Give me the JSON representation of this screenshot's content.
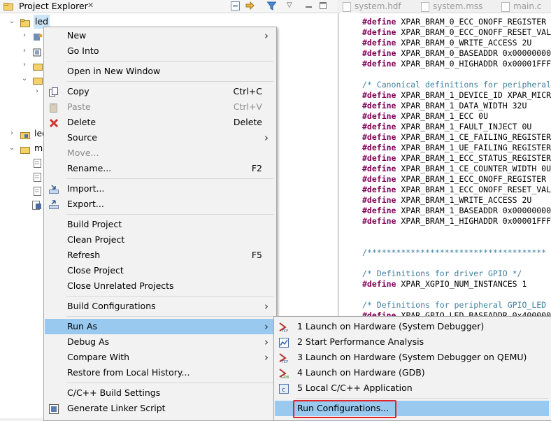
{
  "project_explorer": {
    "title": "Project Explorer",
    "tree": [
      {
        "label": "led",
        "level": 0,
        "expanded": true,
        "selected": true
      },
      {
        "label": "",
        "level": 1
      },
      {
        "label": "",
        "level": 1
      },
      {
        "label": "",
        "level": 1
      },
      {
        "label": "",
        "level": 1
      },
      {
        "label": "",
        "level": 2
      },
      {
        "label": "led",
        "level": 0
      },
      {
        "label": "ml",
        "level": 0,
        "expanded": true
      }
    ]
  },
  "editor_tabs": [
    "system.hdf",
    "system.mss",
    "main.c"
  ],
  "code_lines": [
    {
      "t": "#define XPAR_BRAM_0_ECC_ONOFF_REGISTER",
      "k": true
    },
    {
      "t": "#define XPAR_BRAM_0_ECC_ONOFF_RESET_VAL",
      "k": true
    },
    {
      "t": "#define XPAR_BRAM_0_WRITE_ACCESS 2U",
      "k": true
    },
    {
      "t": "#define XPAR_BRAM_0_BASEADDR 0x00000000",
      "k": true
    },
    {
      "t": "#define XPAR_BRAM_0_HIGHADDR 0x00001FFF",
      "k": true
    },
    {
      "t": "",
      "k": false
    },
    {
      "t": "/* Canonical definitions for peripheral",
      "c": true
    },
    {
      "t": "#define XPAR_BRAM_1_DEVICE_ID XPAR_MICR",
      "k": true
    },
    {
      "t": "#define XPAR_BRAM_1_DATA_WIDTH 32U",
      "k": true
    },
    {
      "t": "#define XPAR_BRAM_1_ECC 0U",
      "k": true
    },
    {
      "t": "#define XPAR_BRAM_1_FAULT_INJECT 0U",
      "k": true
    },
    {
      "t": "#define XPAR_BRAM_1_CE_FAILING_REGISTER",
      "k": true
    },
    {
      "t": "#define XPAR_BRAM_1_UE_FAILING_REGISTER",
      "k": true
    },
    {
      "t": "#define XPAR_BRAM_1_ECC_STATUS_REGISTER",
      "k": true
    },
    {
      "t": "#define XPAR_BRAM_1_CE_COUNTER_WIDTH 0U",
      "k": true
    },
    {
      "t": "#define XPAR_BRAM_1_ECC_ONOFF_REGISTER",
      "k": true
    },
    {
      "t": "#define XPAR_BRAM_1_ECC_ONOFF_RESET_VAL",
      "k": true
    },
    {
      "t": "#define XPAR_BRAM_1_WRITE_ACCESS 2U",
      "k": true
    },
    {
      "t": "#define XPAR_BRAM_1_BASEADDR 0x00000000",
      "k": true
    },
    {
      "t": "#define XPAR_BRAM_1_HIGHADDR 0x00001FFF",
      "k": true
    },
    {
      "t": "",
      "k": false
    },
    {
      "t": "",
      "k": false
    },
    {
      "t": "/*************************************",
      "c": true
    },
    {
      "t": "",
      "k": false
    },
    {
      "t": "/* Definitions for driver GPIO */",
      "c": true
    },
    {
      "t": "#define XPAR_XGPIO_NUM_INSTANCES 1",
      "k": true
    },
    {
      "t": "",
      "k": false
    },
    {
      "t": "/* Definitions for peripheral GPIO_LED",
      "c": true
    },
    {
      "t": "#define XPAR_GPIO_LED_BASEADDR 0x40000000",
      "k": true
    }
  ],
  "context_menu": {
    "items": [
      {
        "type": "item",
        "label": "New",
        "submenu": true
      },
      {
        "type": "item",
        "label": "Go Into"
      },
      {
        "type": "sep"
      },
      {
        "type": "item",
        "label": "Open in New Window"
      },
      {
        "type": "sep"
      },
      {
        "type": "item",
        "label": "Copy",
        "accel": "Ctrl+C",
        "icon": "copy-icon"
      },
      {
        "type": "item",
        "label": "Paste",
        "accel": "Ctrl+V",
        "icon": "paste-icon",
        "disabled": true
      },
      {
        "type": "item",
        "label": "Delete",
        "accel": "Delete",
        "icon": "delete-icon"
      },
      {
        "type": "item",
        "label": "Source",
        "submenu": true
      },
      {
        "type": "item",
        "label": "Move...",
        "disabled": true
      },
      {
        "type": "item",
        "label": "Rename...",
        "accel": "F2"
      },
      {
        "type": "sep"
      },
      {
        "type": "item",
        "label": "Import...",
        "icon": "import-icon"
      },
      {
        "type": "item",
        "label": "Export...",
        "icon": "export-icon"
      },
      {
        "type": "sep"
      },
      {
        "type": "item",
        "label": "Build Project"
      },
      {
        "type": "item",
        "label": "Clean Project"
      },
      {
        "type": "item",
        "label": "Refresh",
        "accel": "F5"
      },
      {
        "type": "item",
        "label": "Close Project"
      },
      {
        "type": "item",
        "label": "Close Unrelated Projects"
      },
      {
        "type": "sep"
      },
      {
        "type": "item",
        "label": "Build Configurations",
        "submenu": true
      },
      {
        "type": "sep"
      },
      {
        "type": "item",
        "label": "Run As",
        "submenu": true,
        "highlighted": true
      },
      {
        "type": "item",
        "label": "Debug As",
        "submenu": true
      },
      {
        "type": "item",
        "label": "Compare With",
        "submenu": true
      },
      {
        "type": "item",
        "label": "Restore from Local History..."
      },
      {
        "type": "sep"
      },
      {
        "type": "item",
        "label": "C/C++ Build Settings"
      },
      {
        "type": "item",
        "label": "Generate Linker Script",
        "icon": "linker-icon"
      }
    ]
  },
  "run_as_submenu": {
    "items": [
      {
        "label": "1 Launch on Hardware (System Debugger)",
        "icon": "tcf-icon"
      },
      {
        "label": "2 Start Performance Analysis",
        "icon": "perf-icon"
      },
      {
        "label": "3 Launch on Hardware (System Debugger on QEMU)",
        "icon": "tcf-icon"
      },
      {
        "label": "4 Launch on Hardware (GDB)",
        "icon": "gdb-icon"
      },
      {
        "label": "5 Local C/C++ Application",
        "icon": "c-app-icon"
      }
    ],
    "footer": "Run Configurations..."
  },
  "colors": {
    "highlight": "#99c9ef",
    "callout": "#e0262a",
    "keyword": "#7f0055",
    "comment": "#3f7f9f"
  }
}
